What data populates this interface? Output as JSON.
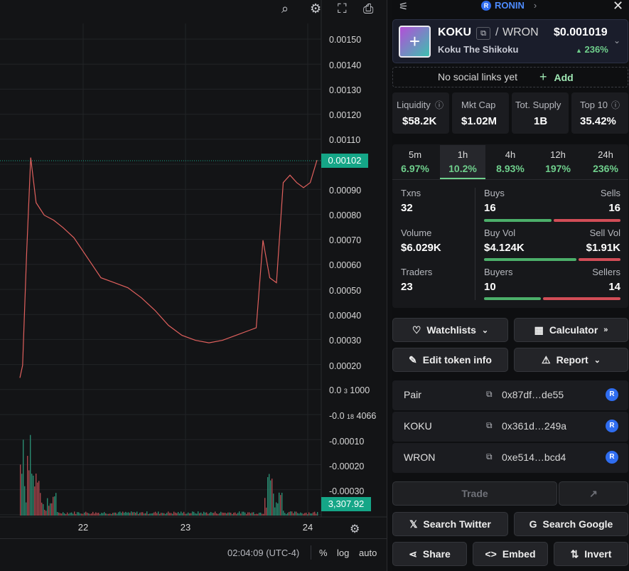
{
  "chain": {
    "name": "RONIN"
  },
  "token": {
    "symbol": "KOKU",
    "quote": "WRON",
    "price": "0.001019",
    "price_prefix": "$",
    "change": "236%",
    "name": "Koku The Shikoku"
  },
  "social": {
    "text": "No social links yet",
    "add_label": "Add"
  },
  "stats": [
    {
      "label": "Liquidity",
      "value": "58.2K",
      "prefix": "$"
    },
    {
      "label": "Mkt Cap",
      "value": "1.02M",
      "prefix": "$"
    },
    {
      "label": "Tot. Supply",
      "value": "1B",
      "prefix": ""
    },
    {
      "label": "Top 10",
      "value": "35.42%",
      "prefix": ""
    }
  ],
  "timeframes": [
    {
      "label": "5m",
      "change": "6.97%"
    },
    {
      "label": "1h",
      "change": "10.2%"
    },
    {
      "label": "4h",
      "change": "8.93%"
    },
    {
      "label": "12h",
      "change": "197%"
    },
    {
      "label": "24h",
      "change": "236%"
    }
  ],
  "txn": {
    "txns_label": "Txns",
    "txns": "32",
    "buys_label": "Buys",
    "buys": "16",
    "sells_label": "Sells",
    "sells": "16",
    "volume_label": "Volume",
    "volume": "6.029K",
    "buyvol_label": "Buy Vol",
    "buyvol": "4.124K",
    "sellvol_label": "Sell Vol",
    "sellvol": "1.91K",
    "traders_label": "Traders",
    "traders": "23",
    "buyers_label": "Buyers",
    "buyers": "10",
    "sellers_label": "Sellers",
    "sellers": "14",
    "buy_share": 0.5,
    "buyvol_share": 0.68,
    "buyer_share": 0.42
  },
  "actions": {
    "watchlists": "Watchlists",
    "calculator": "Calculator",
    "edit": "Edit token info",
    "report": "Report"
  },
  "addresses": [
    {
      "name": "Pair",
      "addr": "0x87df…de55"
    },
    {
      "name": "KOKU",
      "addr": "0x361d…249a"
    },
    {
      "name": "WRON",
      "addr": "0xe514…bcd4"
    }
  ],
  "bottom": {
    "trade": "Trade",
    "twitter": "Search Twitter",
    "google": "Search Google",
    "share": "Share",
    "embed": "Embed",
    "invert": "Invert"
  },
  "chart": {
    "time": "02:04:09 (UTC-4)",
    "pct": "%",
    "log": "log",
    "auto": "auto",
    "price_tag": "0.00102",
    "volume_tag": "3,307.92",
    "axis_labels": [
      "0.00150",
      "0.00140",
      "0.00130",
      "0.00120",
      "0.00110",
      "0.00090",
      "0.00080",
      "0.00070",
      "0.00060",
      "0.00050",
      "0.00040",
      "0.00030",
      "0.00020",
      "-0.00010",
      "-0.00020",
      "-0.00030"
    ],
    "axis_sub1_a": "0.0",
    "axis_sub1_b": "3",
    "axis_sub1_c": "1000",
    "axis_sub2_a": "-0.0",
    "axis_sub2_b": "18",
    "axis_sub2_c": "4066",
    "x_labels": [
      "22",
      "23",
      "24"
    ]
  },
  "chart_data": {
    "type": "line",
    "title": "",
    "xlabel": "",
    "ylabel": "",
    "x_ticks": [
      "22",
      "23",
      "24"
    ],
    "ylim": [
      -0.0003,
      0.0015
    ],
    "series": [
      {
        "x": [
          0.0,
          0.02,
          0.05,
          0.08,
          0.12,
          0.18,
          0.25,
          0.32,
          0.4,
          0.5,
          0.6,
          0.7,
          0.8,
          0.9,
          1.0,
          1.1,
          1.2,
          1.3,
          1.4,
          1.5,
          1.6,
          1.7,
          1.75,
          1.8,
          1.85,
          1.9,
          1.95,
          2.0,
          2.05,
          2.1,
          2.15,
          2.2
        ],
        "values": [
          0.00015,
          0.0002,
          0.00065,
          0.00103,
          0.00085,
          0.0008,
          0.00078,
          0.00075,
          0.00071,
          0.00063,
          0.00055,
          0.00053,
          0.00051,
          0.00047,
          0.00042,
          0.00036,
          0.00032,
          0.0003,
          0.00029,
          0.0003,
          0.00032,
          0.00034,
          0.00035,
          0.0007,
          0.00055,
          0.00053,
          0.00093,
          0.00096,
          0.00093,
          0.00091,
          0.00093,
          0.00102
        ]
      }
    ]
  }
}
